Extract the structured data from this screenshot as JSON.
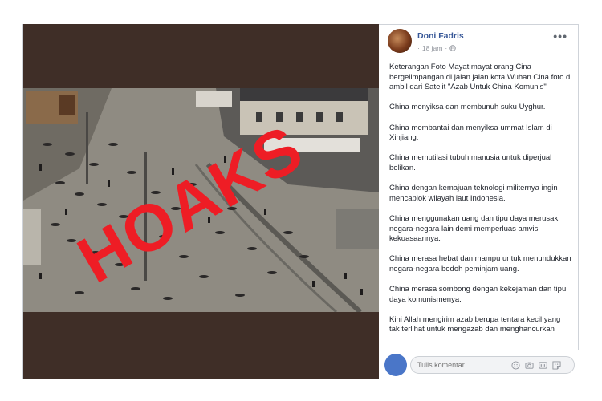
{
  "post": {
    "author": "Doni Fadris",
    "time": "18 jam",
    "time_separator": "·",
    "menu_glyph": "•••",
    "paragraphs": [
      "Keterangan Foto Mayat mayat orang Cina bergelimpangan di jalan jalan kota Wuhan Cina foto di ambil dari Satelit \"Azab Untuk China Komunis\"",
      "China menyiksa dan membunuh suku Uyghur.",
      "China membantai dan menyiksa ummat Islam di Xinjiang.",
      "China memutilasi tubuh manusia untuk diperjual belikan.",
      "China dengan kemajuan teknologi militernya ingin mencaplok wilayah laut Indonesia.",
      "China menggunakan uang dan tipu daya merusak negara-negara lain demi memperluas amvisi kekuasaannya.",
      "China merasa hebat dan mampu untuk menundukkan negara-negara bodoh peminjam uang.",
      "China merasa sombong dengan kekejaman dan tipu daya komunismenya.",
      "Kini Allah mengirim azab berupa tentara kecil yang tak terlihat untuk mengazab dan menghancurkan"
    ]
  },
  "photo": {
    "stamp_text": "HOAKS",
    "stamp_color": "#ee1d25",
    "panel_color": "#3f2e27"
  },
  "comment": {
    "placeholder": "Tulis komentar...",
    "icons": [
      "emoji-icon",
      "camera-icon",
      "gif-icon",
      "sticker-icon"
    ]
  }
}
